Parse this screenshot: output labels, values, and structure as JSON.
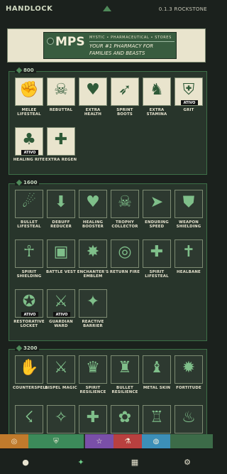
{
  "app": {
    "logo_text": "HANDLOCK",
    "version_text": "0.1.3 ROCKSTONE"
  },
  "banner": {
    "title": "MPS",
    "subtitle": "MYSTIC • PHARMACEUTICAL • STORES",
    "tagline_1": "YOUR #1 PHARMACY FOR",
    "tagline_2": "FAMILIES AND BEASTS"
  },
  "sections": [
    {
      "tier": "800",
      "items": [
        {
          "name": "MELEE LIFESTEAL",
          "icon": "fist-blood-icon",
          "badge": ""
        },
        {
          "name": "REBUTTAL",
          "icon": "horned-skull-icon",
          "badge": ""
        },
        {
          "name": "EXTRA HEALTH",
          "icon": "heart-plus-icon",
          "badge": ""
        },
        {
          "name": "SPRINT BOOTS",
          "icon": "winged-boot-icon",
          "badge": ""
        },
        {
          "name": "EXTRA STAMINA",
          "icon": "horse-icon",
          "badge": ""
        },
        {
          "name": "GRIT",
          "icon": "shield-plus-icon",
          "badge": "ATIVO"
        },
        {
          "name": "HEALING RITE",
          "icon": "tree-icon",
          "badge": "ATIVO"
        },
        {
          "name": "EXTRA REGEN",
          "icon": "bandage-icon",
          "badge": ""
        }
      ]
    },
    {
      "tier": "1600",
      "items": [
        {
          "name": "BULLET LIFESTEAL",
          "icon": "fanged-mouth-icon",
          "badge": ""
        },
        {
          "name": "DEBUFF REDUCER",
          "icon": "down-arrow-icon",
          "badge": ""
        },
        {
          "name": "HEALING BOOSTER",
          "icon": "heart-booster-icon",
          "badge": ""
        },
        {
          "name": "TROPHY COLLECTOR",
          "icon": "trophy-skull-icon",
          "badge": ""
        },
        {
          "name": "ENDURING SPEED",
          "icon": "runner-icon",
          "badge": ""
        },
        {
          "name": "WEAPON SHIELDING",
          "icon": "bullet-shield-icon",
          "badge": ""
        },
        {
          "name": "SPIRIT SHIELDING",
          "icon": "spirit-figure-icon",
          "badge": ""
        },
        {
          "name": "BATTLE VEST",
          "icon": "vest-icon",
          "badge": ""
        },
        {
          "name": "ENCHANTER'S EMBLEM",
          "icon": "star-burst-icon",
          "badge": ""
        },
        {
          "name": "RETURN FIRE",
          "icon": "target-figure-icon",
          "badge": ""
        },
        {
          "name": "SPIRIT LIFESTEAL",
          "icon": "heart-cross-icon",
          "badge": ""
        },
        {
          "name": "HEALBANE",
          "icon": "reaper-icon",
          "badge": ""
        },
        {
          "name": "RESTORATIVE LOCKET",
          "icon": "locket-icon",
          "badge": "ATIVO"
        },
        {
          "name": "GUARDIAN WARD",
          "icon": "sword-bird-icon",
          "badge": "ATIVO"
        },
        {
          "name": "REACTIVE BARRIER",
          "icon": "wing-shield-icon",
          "badge": ""
        }
      ]
    },
    {
      "tier": "3200",
      "items": [
        {
          "name": "COUNTERSPELL",
          "icon": "hand-spell-icon",
          "badge": ""
        },
        {
          "name": "DISPEL MAGIC",
          "icon": "crossed-swords-icon",
          "badge": ""
        },
        {
          "name": "SPIRIT RESILIENCE",
          "icon": "spirit-armor-icon",
          "badge": ""
        },
        {
          "name": "BULLET RESILIENCE",
          "icon": "brute-icon",
          "badge": ""
        },
        {
          "name": "METAL SKIN",
          "icon": "knight-icon",
          "badge": ""
        },
        {
          "name": "FORTITUDE",
          "icon": "lion-icon",
          "badge": ""
        },
        {
          "name": "",
          "icon": "green-beam-icon",
          "badge": ""
        },
        {
          "name": "",
          "icon": "sparkle-icon",
          "badge": ""
        },
        {
          "name": "",
          "icon": "hand-plus-icon",
          "badge": ""
        },
        {
          "name": "",
          "icon": "fairy-icon",
          "badge": ""
        },
        {
          "name": "",
          "icon": "chest-icon",
          "badge": ""
        },
        {
          "name": "",
          "icon": "flame-figure-icon",
          "badge": ""
        }
      ]
    }
  ],
  "tabs": [
    {
      "icon": "target-icon",
      "color": "#c07a2c"
    },
    {
      "icon": "shield-icon",
      "color": "#3c8a5a"
    },
    {
      "icon": "star-icon",
      "color": "#7a4fa8"
    },
    {
      "icon": "flask-icon",
      "color": "#b8403f"
    },
    {
      "icon": "globe-icon",
      "color": "#3c8fb8"
    }
  ],
  "bottom_nav": [
    {
      "icon": "user-icon"
    },
    {
      "icon": "sparkle-nav-icon"
    },
    {
      "icon": "calendar-icon"
    },
    {
      "icon": "settings-icon"
    }
  ],
  "colors": {
    "background": "#1b211d",
    "section_border": "#3d7048",
    "card_bg": "#e9e4cd",
    "accent_green": "#4f8a5a"
  }
}
